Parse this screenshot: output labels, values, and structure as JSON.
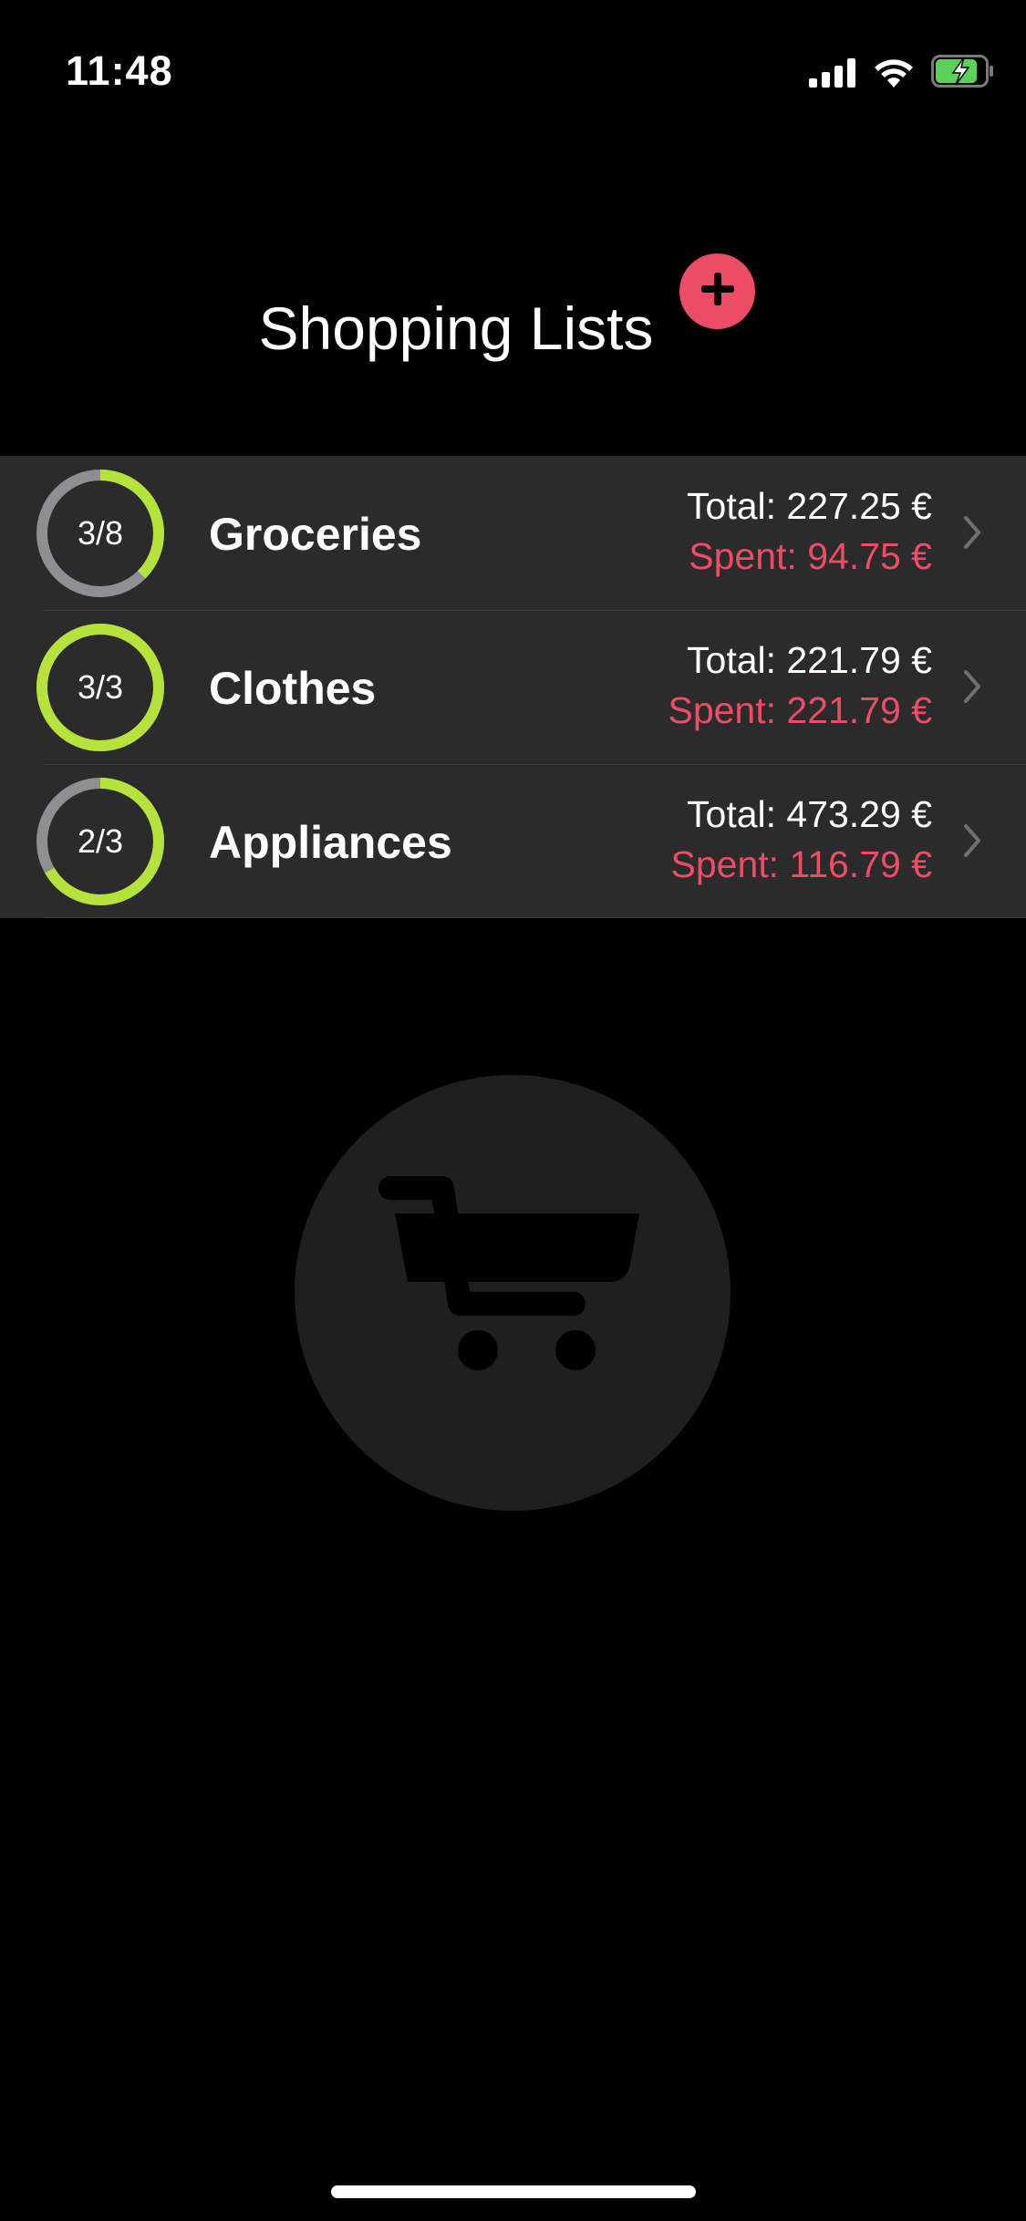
{
  "status_bar": {
    "time": "11:48",
    "icons": [
      "signal-icon",
      "wifi-icon",
      "battery-charging-icon"
    ]
  },
  "header": {
    "title": "Shopping Lists",
    "add_icon": "plus-icon"
  },
  "lists": [
    {
      "name": "Groceries",
      "progress_label": "3/8",
      "progress_fraction": 0.375,
      "total": "Total: 227.25 €",
      "spent": "Spent: 94.75 €"
    },
    {
      "name": "Clothes",
      "progress_label": "3/3",
      "progress_fraction": 1.0,
      "total": "Total: 221.79 €",
      "spent": "Spent: 221.79 €"
    },
    {
      "name": "Appliances",
      "progress_label": "2/3",
      "progress_fraction": 0.667,
      "total": "Total: 473.29 €",
      "spent": "Spent: 116.79 €"
    }
  ],
  "empty_state": {
    "icon": "cart-icon"
  },
  "colors": {
    "accent": "#ec4c66",
    "progress": "#b6e23c",
    "track": "#8e8e93",
    "row_background": "#2b2b2b",
    "background": "#000000"
  }
}
